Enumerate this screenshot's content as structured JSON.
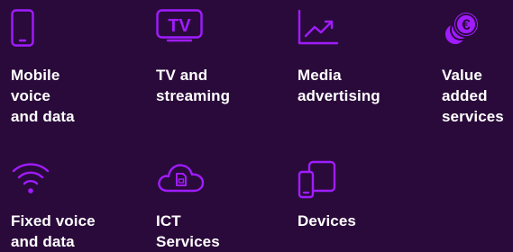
{
  "colors": {
    "background": "#2a0a3a",
    "icon": "#a01cff",
    "text": "#ffffff"
  },
  "tiles": [
    {
      "icon": "mobile-phone-icon",
      "label": "Mobile\nvoice\nand data"
    },
    {
      "icon": "tv-icon",
      "label": "TV and\nstreaming",
      "icon_text": "TV"
    },
    {
      "icon": "trend-chart-icon",
      "label": "Media\nadvertising"
    },
    {
      "icon": "euro-coins-icon",
      "label": "Value\nadded\nservices",
      "icon_text": "€"
    },
    {
      "icon": "wifi-icon",
      "label": "Fixed voice\nand data"
    },
    {
      "icon": "cloud-sim-icon",
      "label": "ICT\nServices"
    },
    {
      "icon": "devices-icon",
      "label": "Devices"
    }
  ]
}
